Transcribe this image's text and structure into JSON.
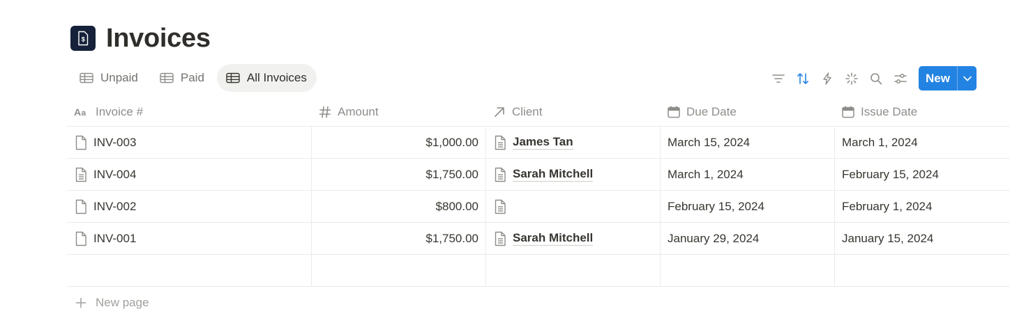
{
  "page": {
    "title": "Invoices",
    "icon": "dollar-document-icon",
    "accent": "#2383e2"
  },
  "views": [
    {
      "label": "Unpaid",
      "icon": "table-icon",
      "active": false
    },
    {
      "label": "Paid",
      "icon": "table-icon",
      "active": false
    },
    {
      "label": "All Invoices",
      "icon": "table-icon",
      "active": true
    }
  ],
  "toolbar": {
    "icons": [
      "filter-icon",
      "sort-icon",
      "automation-icon",
      "ai-sparkle-icon",
      "search-icon",
      "settings-sliders-icon"
    ],
    "new_label": "New"
  },
  "table": {
    "columns": [
      {
        "label": "Invoice #",
        "icon": "text-type-icon"
      },
      {
        "label": "Amount",
        "icon": "number-hash-icon"
      },
      {
        "label": "Client",
        "icon": "relation-arrow-icon"
      },
      {
        "label": "Due Date",
        "icon": "calendar-icon"
      },
      {
        "label": "Issue Date",
        "icon": "calendar-icon"
      }
    ],
    "rows": [
      {
        "invoice": "INV-003",
        "amount": "$1,000.00",
        "client": "James Tan",
        "due": "March 15, 2024",
        "issue": "March 1, 2024",
        "page_icon": "blank-page-icon"
      },
      {
        "invoice": "INV-004",
        "amount": "$1,750.00",
        "client": "Sarah Mitchell",
        "due": "March 1, 2024",
        "issue": "February 15, 2024",
        "page_icon": "text-page-icon"
      },
      {
        "invoice": "INV-002",
        "amount": "$800.00",
        "client": "",
        "due": "February 15, 2024",
        "issue": "February 1, 2024",
        "page_icon": "blank-page-icon"
      },
      {
        "invoice": "INV-001",
        "amount": "$1,750.00",
        "client": "Sarah Mitchell",
        "due": "January 29, 2024",
        "issue": "January 15, 2024",
        "page_icon": "blank-page-icon"
      }
    ]
  },
  "footer": {
    "new_page_label": "New page"
  }
}
